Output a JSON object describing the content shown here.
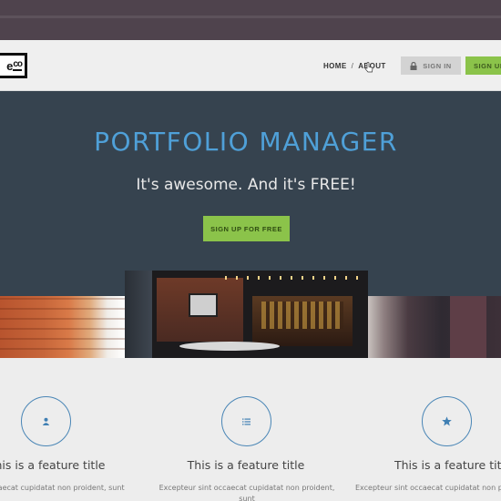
{
  "header": {
    "logo_text": "e",
    "logo_suffix": "co",
    "nav": [
      {
        "label": "HOME"
      },
      {
        "label": "ABOUT"
      }
    ],
    "separator": "/",
    "sign_in_label": "SIGN IN",
    "sign_up_label": "SIGN UP"
  },
  "hero": {
    "title": "PORTFOLIO MANAGER",
    "subtitle": "It's awesome. And it's FREE!",
    "cta_label": "SIGN UP FOR FREE"
  },
  "features": [
    {
      "icon": "user-icon",
      "title": "his is a feature title",
      "text": "at occaecat cupidatat non proident, sunt"
    },
    {
      "icon": "list-icon",
      "title": "This is a feature title",
      "text": "Excepteur sint occaecat cupidatat non proident, sunt"
    },
    {
      "icon": "star-icon",
      "title": "This is a feature title",
      "text": "Excepteur sint occaecat cupidatat non pr"
    }
  ],
  "colors": {
    "topbar": "#4f434d",
    "hero_bg": "#36434f",
    "accent_blue": "#4fa0d8",
    "accent_green": "#8bc34a"
  }
}
